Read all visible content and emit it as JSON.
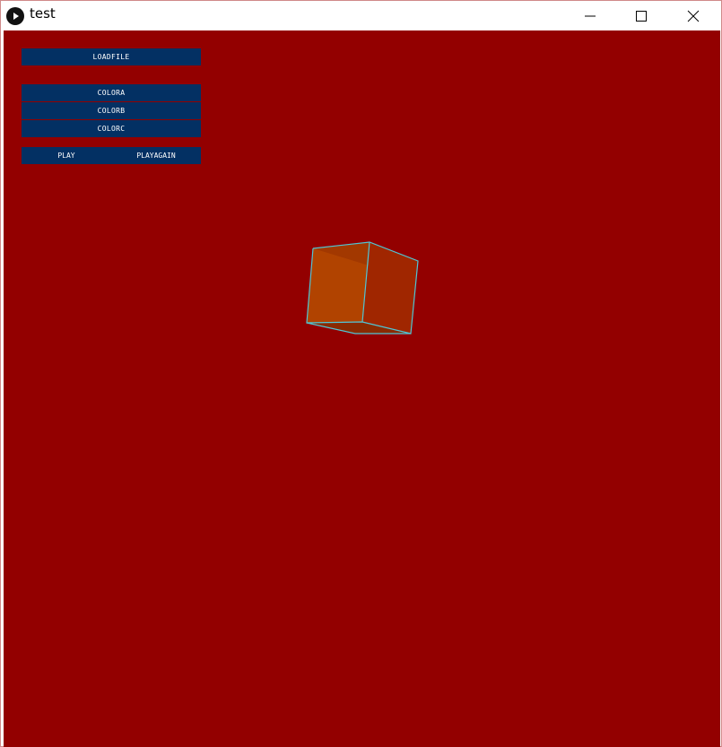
{
  "window": {
    "title": "test"
  },
  "colors": {
    "canvas_bg": "#930000",
    "button_bg": "#033063",
    "cube_edge": "#4fc6d6",
    "cube_left_face": "#b14300",
    "cube_right_face": "#a02600"
  },
  "controls": {
    "loadfile": "LOADFILE",
    "color_a": "COLORA",
    "color_b": "COLORB",
    "color_c": "COLORC",
    "play": "PLAY",
    "play_again": "PLAYAGAIN"
  },
  "icons": {
    "app": "play-icon",
    "minimize": "minimize-icon",
    "maximize": "maximize-icon",
    "close": "close-icon"
  }
}
